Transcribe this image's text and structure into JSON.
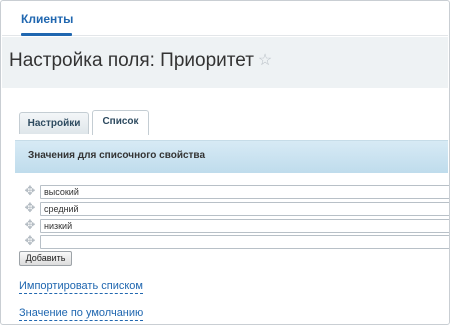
{
  "nav": {
    "tab_label": "Клиенты"
  },
  "header": {
    "title": "Настройка поля: Приоритет",
    "star_glyph": "☆"
  },
  "tabs": [
    {
      "label": "Настройки",
      "active": false
    },
    {
      "label": "Список",
      "active": true
    }
  ],
  "section": {
    "title": "Значения для списочного свойства"
  },
  "values": [
    {
      "value": "высокий"
    },
    {
      "value": "средний"
    },
    {
      "value": "низкий"
    },
    {
      "value": ""
    }
  ],
  "drag_glyph": "✥",
  "buttons": {
    "add_label": "Добавить"
  },
  "links": {
    "import_label": "Импортировать списком",
    "default_label": "Значение по умолчанию"
  },
  "colors": {
    "accent": "#2067b0",
    "header_bg": "#eef2f4",
    "section_bg": "#c9e2ef"
  }
}
